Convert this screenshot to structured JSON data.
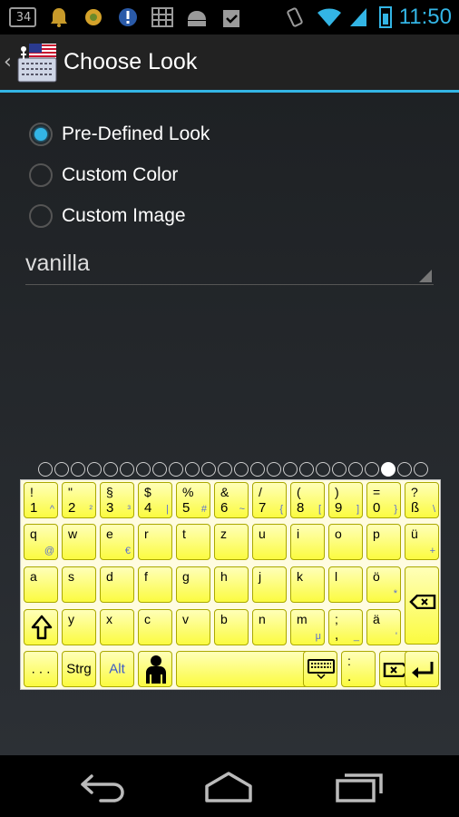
{
  "status_bar": {
    "notif_badge": "34",
    "time": "11:50",
    "icons": [
      "notification-count-icon",
      "bell-icon",
      "flower-icon",
      "alert-icon",
      "grid-icon",
      "android-icon",
      "clipboard-check-icon",
      "vibrate-icon",
      "wifi-icon",
      "signal-icon",
      "battery-icon"
    ]
  },
  "action_bar": {
    "title": "Choose Look",
    "icon": "keyboard-flag-icon"
  },
  "look_options": [
    {
      "label": "Pre-Defined Look",
      "checked": true
    },
    {
      "label": "Custom Color",
      "checked": false
    },
    {
      "label": "Custom Image",
      "checked": false
    }
  ],
  "look_spinner": {
    "value": "vanilla"
  },
  "pager": {
    "count": 24,
    "active_index": 21
  },
  "keyboard": {
    "row1": [
      {
        "top": "!",
        "bottom": "1",
        "alt": "^"
      },
      {
        "top": "\"",
        "bottom": "2",
        "alt": "²"
      },
      {
        "top": "§",
        "bottom": "3",
        "alt": "³"
      },
      {
        "top": "$",
        "bottom": "4",
        "alt": "|"
      },
      {
        "top": "%",
        "bottom": "5",
        "alt": "#"
      },
      {
        "top": "&",
        "bottom": "6",
        "alt": "~"
      },
      {
        "top": "/",
        "bottom": "7",
        "alt": "{"
      },
      {
        "top": "(",
        "bottom": "8",
        "alt": "["
      },
      {
        "top": ")",
        "bottom": "9",
        "alt": "]"
      },
      {
        "top": "=",
        "bottom": "0",
        "alt": "}"
      },
      {
        "top": "?",
        "bottom": "ß",
        "alt": "\\"
      }
    ],
    "row2": [
      {
        "top": "q",
        "alt": "@"
      },
      {
        "top": "w",
        "alt": ""
      },
      {
        "top": "e",
        "alt": "€"
      },
      {
        "top": "r",
        "alt": ""
      },
      {
        "top": "t",
        "alt": ""
      },
      {
        "top": "z",
        "alt": ""
      },
      {
        "top": "u",
        "alt": ""
      },
      {
        "top": "i",
        "alt": ""
      },
      {
        "top": "o",
        "alt": ""
      },
      {
        "top": "p",
        "alt": ""
      },
      {
        "top": "ü",
        "alt": "+"
      }
    ],
    "row3": [
      {
        "top": "a",
        "alt": ""
      },
      {
        "top": "s",
        "alt": ""
      },
      {
        "top": "d",
        "alt": ""
      },
      {
        "top": "f",
        "alt": ""
      },
      {
        "top": "g",
        "alt": ""
      },
      {
        "top": "h",
        "alt": ""
      },
      {
        "top": "j",
        "alt": ""
      },
      {
        "top": "k",
        "alt": ""
      },
      {
        "top": "l",
        "alt": ""
      },
      {
        "top": "ö",
        "alt": "*"
      }
    ],
    "row4": [
      {
        "top": "y",
        "alt": ""
      },
      {
        "top": "x",
        "alt": ""
      },
      {
        "top": "c",
        "alt": ""
      },
      {
        "top": "v",
        "alt": ""
      },
      {
        "top": "b",
        "alt": ""
      },
      {
        "top": "n",
        "alt": ""
      },
      {
        "top": "m",
        "alt": "μ"
      },
      {
        "top": ";",
        "bottom": ",",
        "alt": "_"
      },
      {
        "top": "ä",
        "alt": "'"
      }
    ],
    "row5": {
      "dots": ". . .",
      "strg": "Strg",
      "alt": "Alt",
      "colon_top": ":",
      "colon_bottom": "."
    }
  },
  "colors": {
    "accent": "#33b5e5",
    "key_fill": "#fbfb40",
    "key_alt_text": "#5a6fd1"
  }
}
